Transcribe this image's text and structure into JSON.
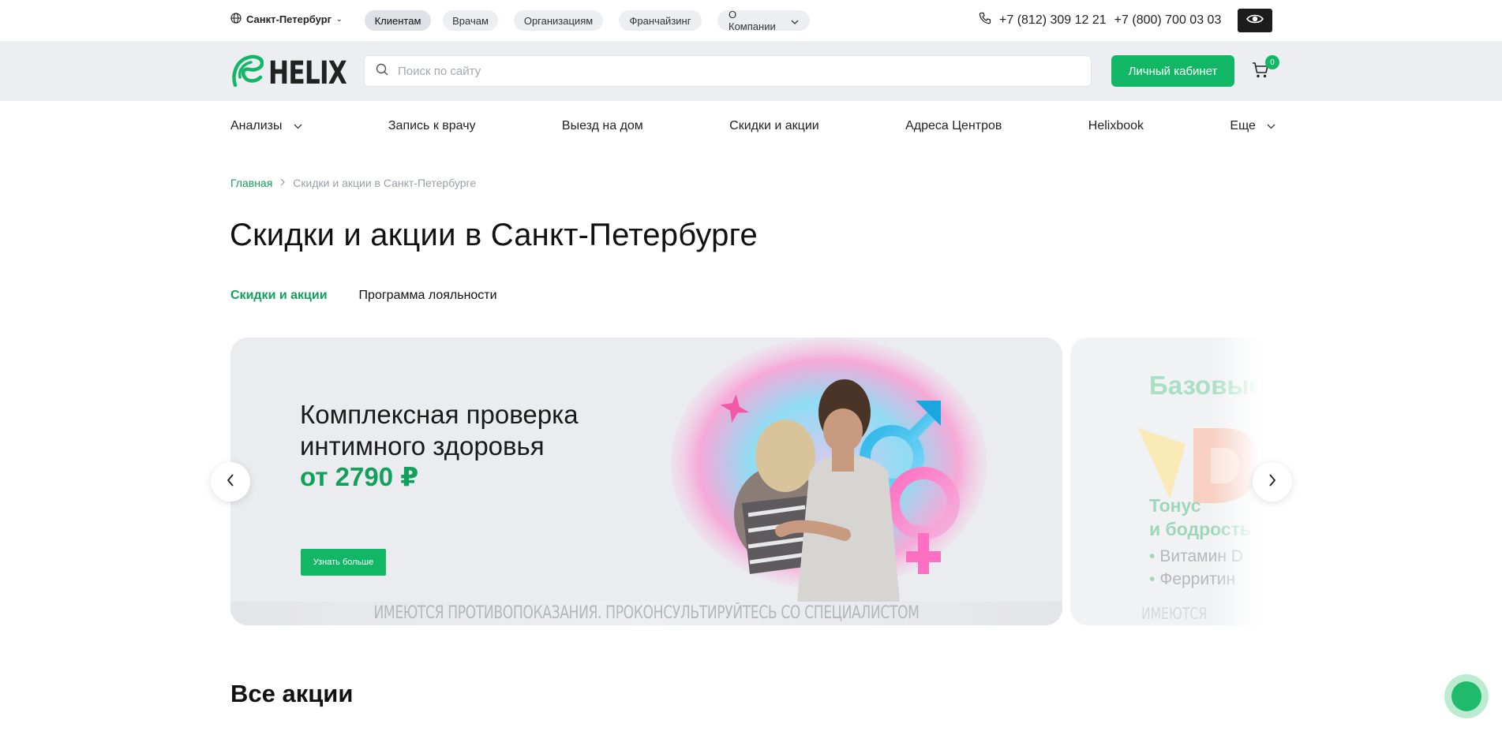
{
  "topbar": {
    "city": "Санкт-Петербург",
    "audience_tabs": [
      "Клиентам",
      "Врачам",
      "Организациям",
      "Франчайзинг"
    ],
    "about_label": "О Компании",
    "phones": [
      "+7 (812) 309 12 21",
      "+7 (800) 700 03 03"
    ]
  },
  "header": {
    "logo_text": "HELIX",
    "search_placeholder": "Поиск по сайту",
    "cabinet_label": "Личный кабинет",
    "cart_count": "0"
  },
  "nav": {
    "items": [
      "Анализы",
      "Запись к врачу",
      "Выезд на дом",
      "Скидки и акции",
      "Адреса Центров",
      "Helixbook",
      "Еще"
    ]
  },
  "breadcrumb": {
    "home": "Главная",
    "current": "Скидки и акции в Санкт-Петербурге"
  },
  "page": {
    "title": "Скидки и акции в Санкт-Петербурге",
    "tabs": [
      "Скидки и акции",
      "Программа лояльности"
    ],
    "section_title": "Все акции"
  },
  "slider": {
    "slide1": {
      "title_line1": "Комплексная проверка",
      "title_line2": "интимного здоровья",
      "price": "от 2790 ₽",
      "button": "Узнать больше",
      "disclaimer": "ИМЕЮТСЯ ПРОТИВОПОКАЗАНИЯ. ПРОКОНСУЛЬТИРУЙТЕСЬ СО СПЕЦИАЛИСТОМ"
    },
    "slide2": {
      "title": "Базовые",
      "subtitle_line1": "Тонус",
      "subtitle_line2": "и бодрость",
      "list": [
        "Витамин D",
        "Ферритин"
      ],
      "disclaimer": "ИМЕЮТСЯ"
    }
  },
  "colors": {
    "brand_green": "#12b766",
    "link_green": "#12a05a",
    "header_bg": "#eceef2"
  }
}
